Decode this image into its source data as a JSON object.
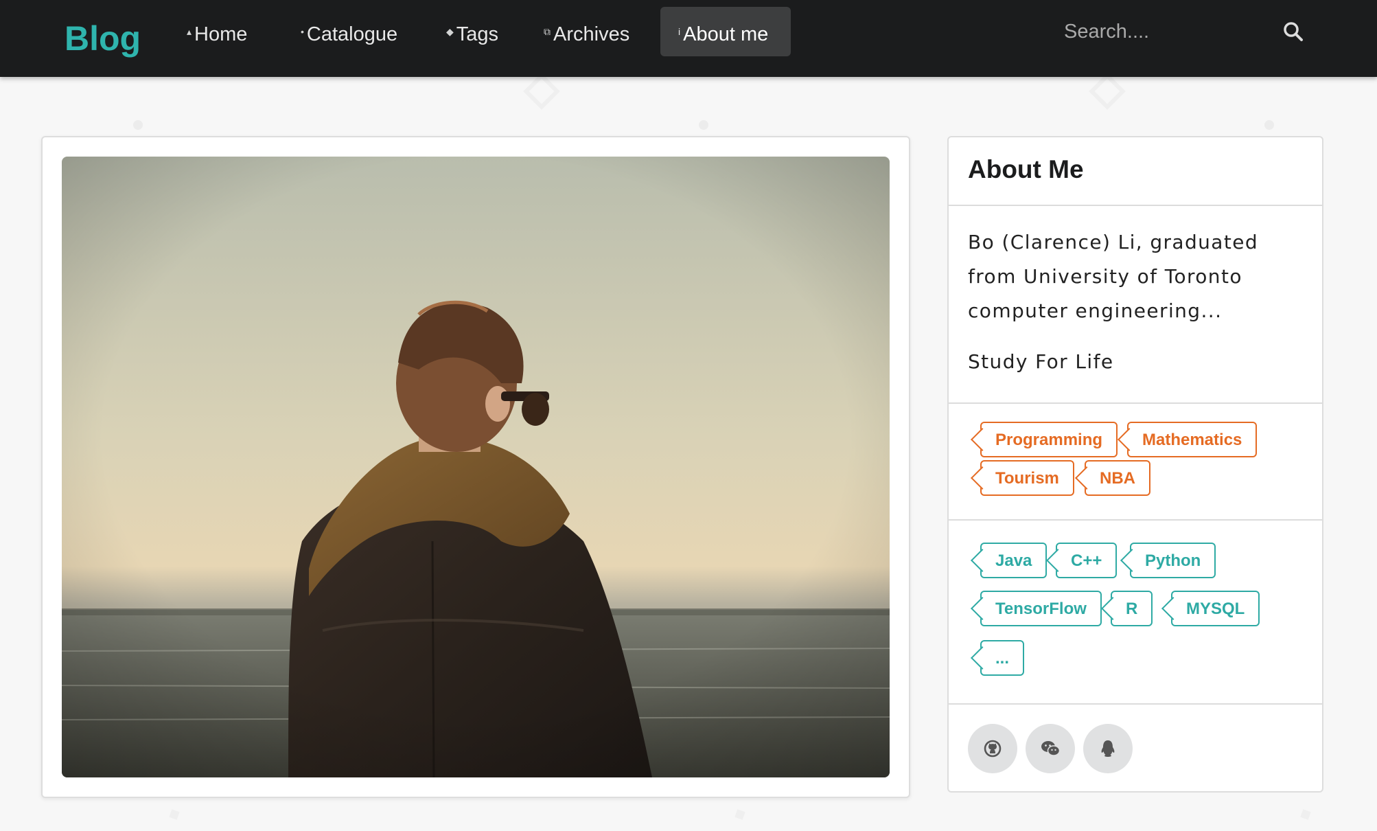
{
  "navbar": {
    "brand": "Blog",
    "items": [
      {
        "label": "Home",
        "icon": "home-icon",
        "glyph": "▴"
      },
      {
        "label": "Catalogue",
        "icon": "idea-icon",
        "glyph": "•"
      },
      {
        "label": "Tags",
        "icon": "tag-icon",
        "glyph": "◆"
      },
      {
        "label": "Archives",
        "icon": "clone-icon",
        "glyph": "⧉"
      },
      {
        "label": "About me",
        "icon": "info-icon",
        "glyph": "i",
        "active": true
      }
    ],
    "search": {
      "placeholder": "Search...."
    }
  },
  "photo": {
    "subject": "person in leather jacket and scarf facing the sea"
  },
  "sidebar": {
    "title": "About Me",
    "bio": "Bo (Clarence) Li, graduated from University of Toronto computer engineering...",
    "motto": "Study For Life",
    "interests": [
      "Programming",
      "Mathematics",
      "Tourism",
      "NBA"
    ],
    "skills": [
      "Java",
      "C++",
      "Python",
      "TensorFlow",
      "R",
      "MYSQL",
      "..."
    ],
    "social": [
      "github-icon",
      "wechat-icon",
      "qq-icon"
    ]
  },
  "colors": {
    "brand": "#2fb4ad",
    "navbar_bg": "#1b1c1d",
    "interest_tag": "#e56b23",
    "skill_tag": "#2eaaa4"
  }
}
